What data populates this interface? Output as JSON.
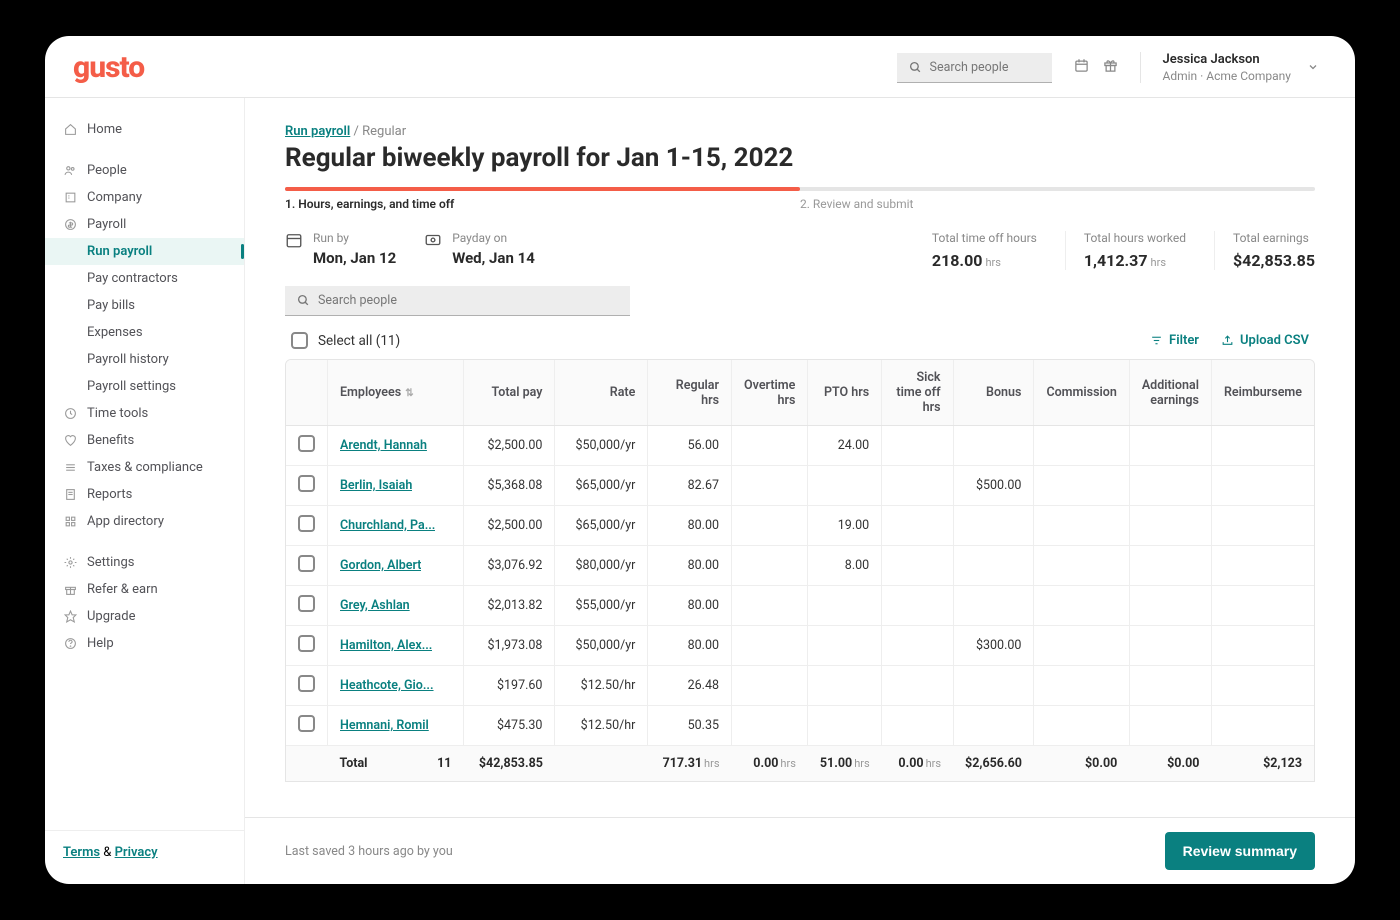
{
  "logo": "gusto",
  "header": {
    "search_placeholder": "Search people",
    "user_name": "Jessica Jackson",
    "user_sub": "Admin · Acme Company"
  },
  "sidebar": {
    "items": [
      {
        "label": "Home",
        "icon": "home"
      },
      {
        "gap": true
      },
      {
        "label": "People",
        "icon": "people"
      },
      {
        "label": "Company",
        "icon": "company"
      },
      {
        "label": "Payroll",
        "icon": "payroll",
        "expanded": true,
        "children": [
          {
            "label": "Run payroll",
            "active": true
          },
          {
            "label": "Pay contractors"
          },
          {
            "label": "Pay bills"
          },
          {
            "label": "Expenses"
          },
          {
            "label": "Payroll history"
          },
          {
            "label": "Payroll settings"
          }
        ]
      },
      {
        "label": "Time tools",
        "icon": "time"
      },
      {
        "label": "Benefits",
        "icon": "benefits"
      },
      {
        "label": "Taxes & compliance",
        "icon": "taxes"
      },
      {
        "label": "Reports",
        "icon": "reports"
      },
      {
        "label": "App directory",
        "icon": "apps"
      },
      {
        "gap": true
      },
      {
        "label": "Settings",
        "icon": "settings"
      },
      {
        "label": "Refer & earn",
        "icon": "refer"
      },
      {
        "label": "Upgrade",
        "icon": "upgrade"
      },
      {
        "label": "Help",
        "icon": "help"
      }
    ],
    "footer_terms": "Terms",
    "footer_amp": " & ",
    "footer_privacy": "Privacy"
  },
  "breadcrumb": {
    "root": "Run payroll",
    "sep": " / ",
    "leaf": "Regular"
  },
  "page_title": "Regular biweekly payroll for Jan 1-15, 2022",
  "steps": {
    "s1": "1. Hours, earnings, and time off",
    "s2": "2. Review and submit"
  },
  "runby": {
    "label": "Run by",
    "value": "Mon, Jan 12"
  },
  "payday": {
    "label": "Payday on",
    "value": "Wed, Jan 14"
  },
  "metrics": {
    "timeoff": {
      "label": "Total time off hours",
      "value": "218.00",
      "unit": "hrs"
    },
    "worked": {
      "label": "Total hours worked",
      "value": "1,412.37",
      "unit": "hrs"
    },
    "earnings": {
      "label": "Total earnings",
      "value": "$42,853.85"
    }
  },
  "table_search_placeholder": "Search people",
  "select_all_label": "Select all (11)",
  "filter_label": "Filter",
  "upload_label": "Upload CSV",
  "columns": {
    "employees": "Employees",
    "total_pay": "Total pay",
    "rate": "Rate",
    "regular": "Regular hrs",
    "overtime": "Overtime hrs",
    "pto": "PTO hrs",
    "sick": "Sick time off hrs",
    "bonus": "Bonus",
    "commission": "Commission",
    "additional": "Additional earnings",
    "reimb": "Reimburseme"
  },
  "rows": [
    {
      "name": "Arendt, Hannah",
      "pay": "$2,500.00",
      "rate": "$50,000/yr",
      "reg": "56.00",
      "ot": "",
      "pto": "24.00",
      "sick": "",
      "bonus": "",
      "comm": "",
      "add": "",
      "reimb": ""
    },
    {
      "name": "Berlin, Isaiah",
      "pay": "$5,368.08",
      "rate": "$65,000/yr",
      "reg": "82.67",
      "ot": "",
      "pto": "",
      "sick": "",
      "bonus": "$500.00",
      "comm": "",
      "add": "",
      "reimb": ""
    },
    {
      "name": "Churchland, Pa...",
      "pay": "$2,500.00",
      "rate": "$65,000/yr",
      "reg": "80.00",
      "ot": "",
      "pto": "19.00",
      "sick": "",
      "bonus": "",
      "comm": "",
      "add": "",
      "reimb": ""
    },
    {
      "name": "Gordon, Albert",
      "pay": "$3,076.92",
      "rate": "$80,000/yr",
      "reg": "80.00",
      "ot": "",
      "pto": "8.00",
      "sick": "",
      "bonus": "",
      "comm": "",
      "add": "",
      "reimb": ""
    },
    {
      "name": "Grey, Ashlan",
      "pay": "$2,013.82",
      "rate": "$55,000/yr",
      "reg": "80.00",
      "ot": "",
      "pto": "",
      "sick": "",
      "bonus": "",
      "comm": "",
      "add": "",
      "reimb": ""
    },
    {
      "name": "Hamilton, Alex...",
      "pay": "$1,973.08",
      "rate": "$50,000/yr",
      "reg": "80.00",
      "ot": "",
      "pto": "",
      "sick": "",
      "bonus": "$300.00",
      "comm": "",
      "add": "",
      "reimb": ""
    },
    {
      "name": "Heathcote, Gio...",
      "pay": "$197.60",
      "rate": "$12.50/hr",
      "reg": "26.48",
      "ot": "",
      "pto": "",
      "sick": "",
      "bonus": "",
      "comm": "",
      "add": "",
      "reimb": ""
    },
    {
      "name": "Hemnani, Romil",
      "pay": "$475.30",
      "rate": "$12.50/hr",
      "reg": "50.35",
      "ot": "",
      "pto": "",
      "sick": "",
      "bonus": "",
      "comm": "",
      "add": "",
      "reimb": ""
    }
  ],
  "totals": {
    "label": "Total",
    "count": "11",
    "pay": "$42,853.85",
    "reg": "717.31",
    "ot": "0.00",
    "pto": "51.00",
    "sick": "0.00",
    "bonus": "$2,656.60",
    "comm": "$0.00",
    "add": "$0.00",
    "reimb": "$2,123",
    "unit": "hrs"
  },
  "saved_note": "Last saved 3 hours ago by you",
  "review_btn": "Review summary"
}
